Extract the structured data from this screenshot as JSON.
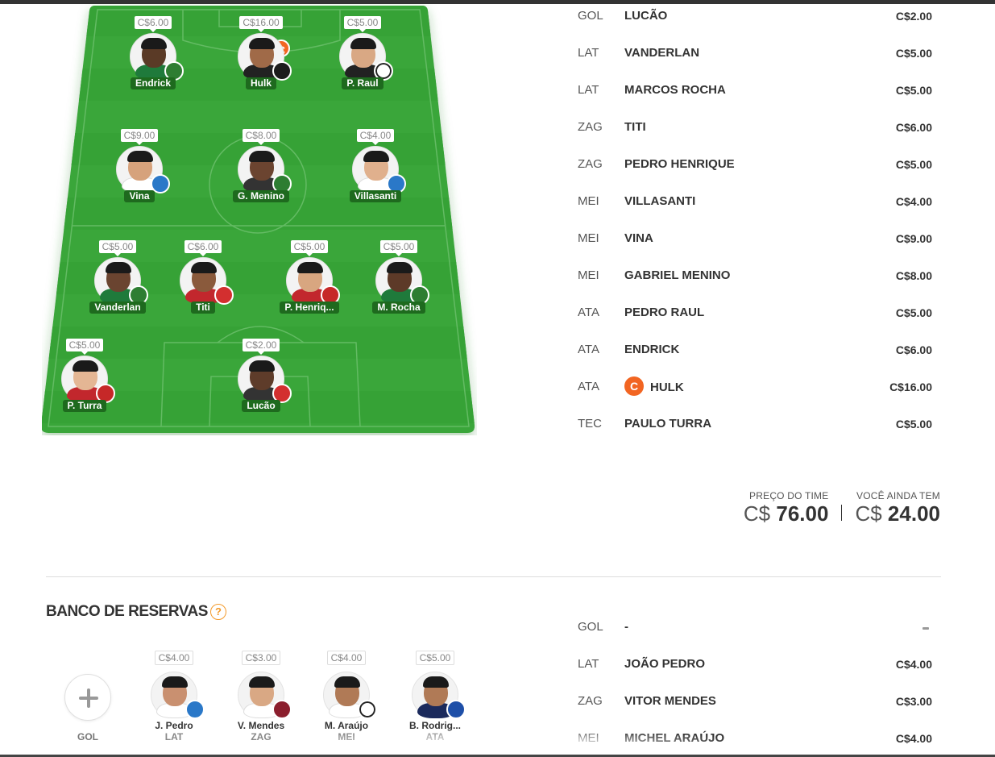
{
  "field": {
    "players": [
      {
        "id": "endrick",
        "price": "C$6.00",
        "name": "Endrick",
        "skin": "#5a3a26",
        "shirt": "#1f7a3b",
        "crest": "#2e7d32",
        "crest_icon": "palmeiras-crest-icon"
      },
      {
        "id": "hulk",
        "price": "C$16.00",
        "name": "Hulk",
        "skin": "#a06a48",
        "shirt": "#222222",
        "crest": "#1c1c1c",
        "crest_icon": "atletico-mg-crest-icon"
      },
      {
        "id": "praul",
        "price": "C$5.00",
        "name": "P. Raul",
        "skin": "#d9a884",
        "shirt": "#222222",
        "crest": "#ffffff",
        "crest_icon": "vasco-crest-icon"
      },
      {
        "id": "vina",
        "price": "C$9.00",
        "name": "Vina",
        "skin": "#d6a27c",
        "shirt": "#ffffff",
        "crest": "#2a78c8",
        "crest_icon": "gremio-crest-icon"
      },
      {
        "id": "gmenino",
        "price": "C$8.00",
        "name": "G. Menino",
        "skin": "#6b4430",
        "shirt": "#333333",
        "crest": "#2e7d32",
        "crest_icon": "palmeiras-crest-icon"
      },
      {
        "id": "villasanti",
        "price": "C$4.00",
        "name": "Villasanti",
        "skin": "#e0b08d",
        "shirt": "#ffffff",
        "crest": "#2a78c8",
        "crest_icon": "gremio-crest-icon"
      },
      {
        "id": "vanderlan",
        "price": "C$5.00",
        "name": "Vanderlan",
        "skin": "#6a4430",
        "shirt": "#1f7a3b",
        "crest": "#2e7d32",
        "crest_icon": "palmeiras-crest-icon"
      },
      {
        "id": "titi",
        "price": "C$6.00",
        "name": "Titi",
        "skin": "#8a5a3c",
        "shirt": "#c2272d",
        "crest": "#d32f2f",
        "crest_icon": "fortaleza-crest-icon"
      },
      {
        "id": "phenrique",
        "price": "C$5.00",
        "name": "P. Henriq...",
        "skin": "#d8a680",
        "shirt": "#c2272d",
        "crest": "#c62828",
        "crest_icon": "athletico-pr-crest-icon"
      },
      {
        "id": "mrocha",
        "price": "C$5.00",
        "name": "M. Rocha",
        "skin": "#5d3a28",
        "shirt": "#1f7a3b",
        "crest": "#2e7d32",
        "crest_icon": "palmeiras-crest-icon"
      },
      {
        "id": "pturra",
        "price": "C$5.00",
        "name": "P. Turra",
        "skin": "#e4b694",
        "shirt": "#c2272d",
        "crest": "#c62828",
        "crest_icon": "athletico-pr-crest-icon"
      },
      {
        "id": "lucao",
        "price": "C$2.00",
        "name": "Lucão",
        "skin": "#5e3c2a",
        "shirt": "#333333",
        "crest": "#d32f2f",
        "crest_icon": "bragantino-crest-icon"
      }
    ],
    "captain_letter": "C"
  },
  "lineup": [
    {
      "pos": "GOL",
      "name": "LUCÃO",
      "price": "C$2.00"
    },
    {
      "pos": "LAT",
      "name": "VANDERLAN",
      "price": "C$5.00"
    },
    {
      "pos": "LAT",
      "name": "MARCOS ROCHA",
      "price": "C$5.00"
    },
    {
      "pos": "ZAG",
      "name": "TITI",
      "price": "C$6.00"
    },
    {
      "pos": "ZAG",
      "name": "PEDRO HENRIQUE",
      "price": "C$5.00"
    },
    {
      "pos": "MEI",
      "name": "VILLASANTI",
      "price": "C$4.00"
    },
    {
      "pos": "MEI",
      "name": "VINA",
      "price": "C$9.00"
    },
    {
      "pos": "MEI",
      "name": "GABRIEL MENINO",
      "price": "C$8.00"
    },
    {
      "pos": "ATA",
      "name": "PEDRO RAUL",
      "price": "C$5.00"
    },
    {
      "pos": "ATA",
      "name": "ENDRICK",
      "price": "C$6.00"
    },
    {
      "pos": "ATA",
      "name": "HULK",
      "price": "C$16.00",
      "captain": "C"
    },
    {
      "pos": "TEC",
      "name": "PAULO TURRA",
      "price": "C$5.00"
    }
  ],
  "totals": {
    "team_price_label": "PREÇO DO TIME",
    "team_price_currency": "C$",
    "team_price_value": "76.00",
    "remaining_label": "VOCÊ AINDA TEM",
    "remaining_currency": "C$",
    "remaining_value": "24.00"
  },
  "bench": {
    "title": "BANCO DE RESERVAS",
    "help": "?",
    "empty_slot_label": "GOL",
    "players": [
      {
        "price": "C$4.00",
        "name": "J. Pedro",
        "pos": "LAT",
        "skin": "#c99070",
        "shirt": "#ffffff",
        "crest": "#2a78c8",
        "crest_icon": "gremio-crest-icon"
      },
      {
        "price": "C$3.00",
        "name": "V. Mendes",
        "pos": "ZAG",
        "skin": "#d9a884",
        "shirt": "#ffffff",
        "crest": "#8b1e2d",
        "crest_icon": "fluminense-crest-icon"
      },
      {
        "price": "C$4.00",
        "name": "M. Araújo",
        "pos": "MEI",
        "skin": "#b07a56",
        "shirt": "#ffffff",
        "crest": "#ffffff",
        "crest_icon": "sao-paulo-crest-icon"
      },
      {
        "price": "C$5.00",
        "name": "B. Rodrig...",
        "pos": "ATA",
        "skin": "#b07a56",
        "shirt": "#1b2a5c",
        "crest": "#1e4fa8",
        "crest_icon": "cruzeiro-crest-icon"
      }
    ],
    "list": [
      {
        "pos": "GOL",
        "name": "-",
        "price": ""
      },
      {
        "pos": "LAT",
        "name": "JOÃO PEDRO",
        "price": "C$4.00"
      },
      {
        "pos": "ZAG",
        "name": "VITOR MENDES",
        "price": "C$3.00"
      },
      {
        "pos": "MEI",
        "name": "MICHEL ARAÚJO",
        "price": "C$4.00"
      }
    ]
  },
  "colors": {
    "field_green": "#3aa63a",
    "field_stripe": "#34a034",
    "captain_orange": "#f26522",
    "name_tag_green": "#1e6a1e",
    "help_orange": "#f39a2b"
  }
}
